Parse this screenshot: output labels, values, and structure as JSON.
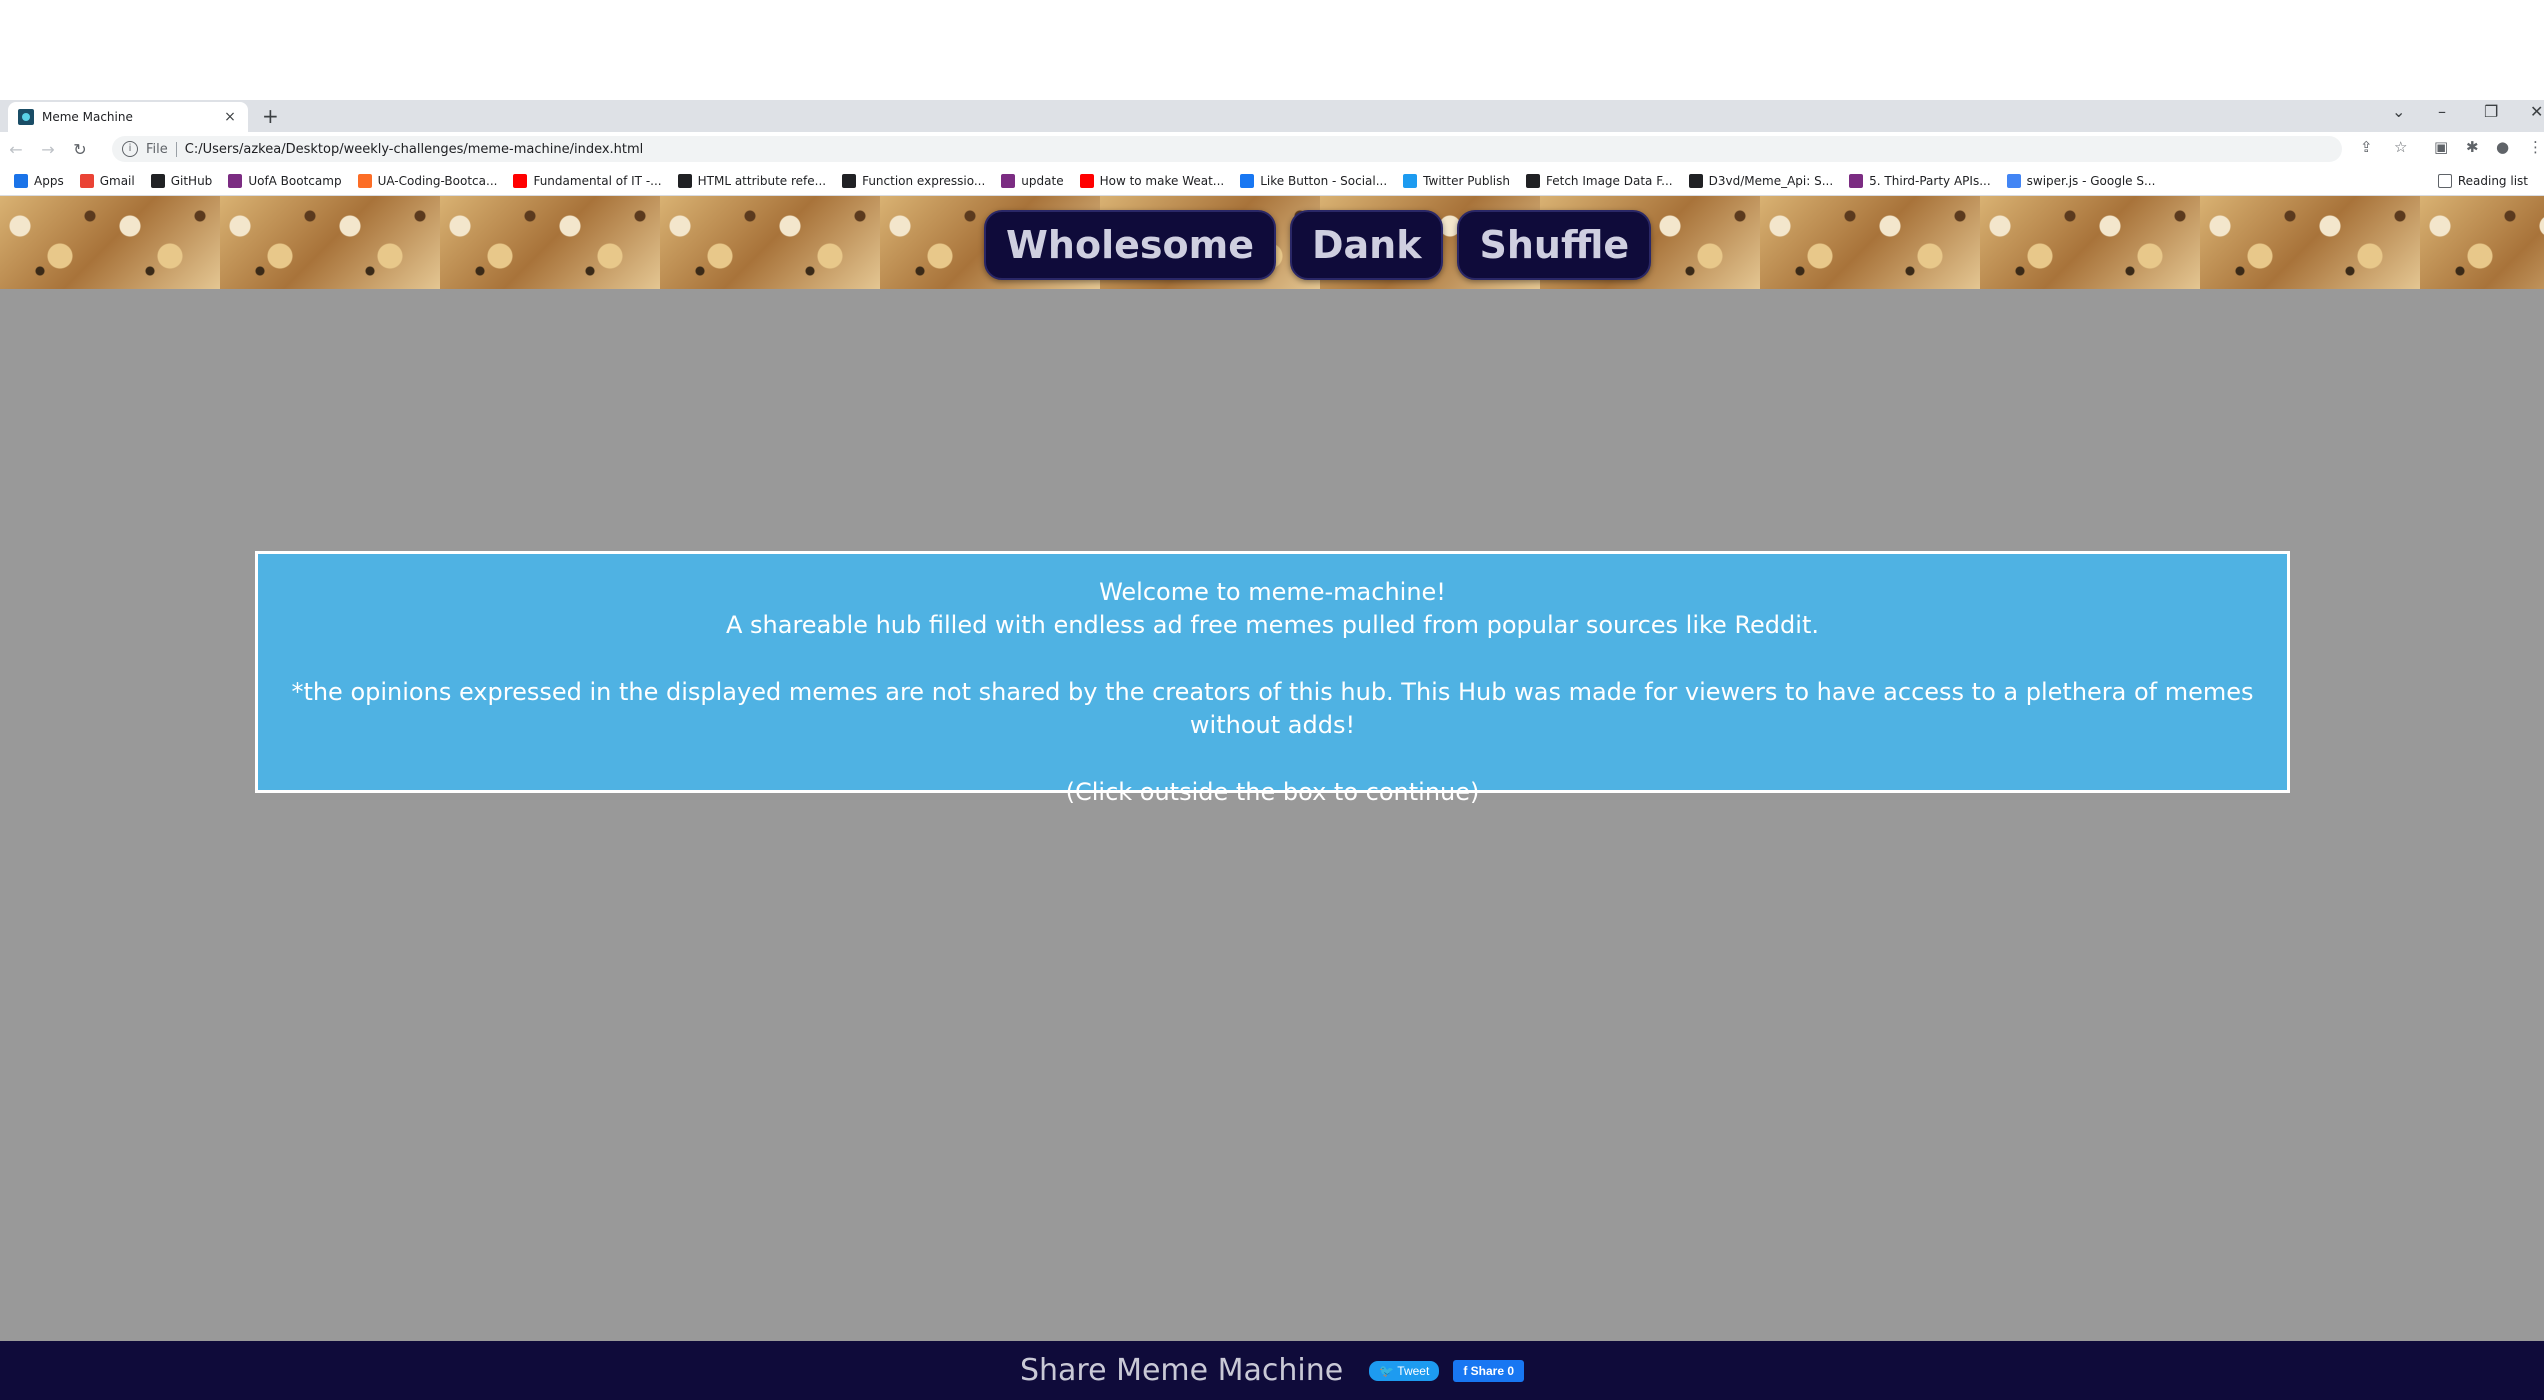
{
  "browser": {
    "tab_title": "Meme Machine",
    "tab_close": "×",
    "new_tab": "+",
    "url_scheme_label": "File",
    "url": "C:/Users/azkea/Desktop/weekly-challenges/meme-machine/index.html",
    "bookmarks": [
      {
        "label": "Apps",
        "color": "#1a73e8"
      },
      {
        "label": "Gmail",
        "color": "#ea4335"
      },
      {
        "label": "GitHub",
        "color": "#202124"
      },
      {
        "label": "UofA Bootcamp",
        "color": "#7b2c82"
      },
      {
        "label": "UA-Coding-Bootca...",
        "color": "#fc6d26"
      },
      {
        "label": "Fundamental of IT -...",
        "color": "#ff0000"
      },
      {
        "label": "HTML attribute refe...",
        "color": "#202124"
      },
      {
        "label": "Function expressio...",
        "color": "#202124"
      },
      {
        "label": "update",
        "color": "#7b2c82"
      },
      {
        "label": "How to make Weat...",
        "color": "#ff0000"
      },
      {
        "label": "Like Button - Social...",
        "color": "#1877f2"
      },
      {
        "label": "Twitter Publish",
        "color": "#1d9bf0"
      },
      {
        "label": "Fetch Image Data F...",
        "color": "#202124"
      },
      {
        "label": "D3vd/Meme_Api: S...",
        "color": "#202124"
      },
      {
        "label": "5. Third-Party APIs...",
        "color": "#7b2c82"
      },
      {
        "label": "swiper.js - Google S...",
        "color": "#4285f4"
      }
    ],
    "reading_list": "Reading list"
  },
  "nav": {
    "wholesome": "Wholesome",
    "dank": "Dank",
    "shuffle": "Shuffle"
  },
  "modal": {
    "line1": "Welcome to meme-machine!",
    "line2": "A shareable hub filled with endless ad free memes pulled from popular sources like Reddit.",
    "disclaimer": "*the opinions expressed in the displayed memes are not shared by the creators of this hub. This Hub was made for viewers to have access to a plethera of memes without adds!",
    "continue": "(Click outside the box to continue)"
  },
  "footer": {
    "share_label": "Share Meme Machine",
    "tweet": "Tweet",
    "fb_share": "Share 0"
  }
}
